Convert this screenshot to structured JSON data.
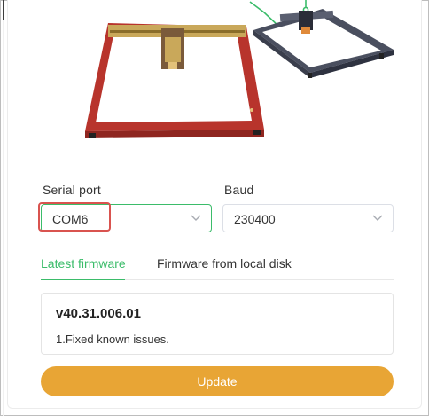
{
  "serial_port": {
    "label": "Serial port",
    "value": "COM6"
  },
  "baud": {
    "label": "Baud",
    "value": "230400"
  },
  "tabs": [
    {
      "label": "Latest firmware",
      "active": true
    },
    {
      "label": "Firmware from local disk",
      "active": false
    }
  ],
  "firmware": {
    "version": "v40.31.006.01",
    "notes": "1.Fixed known issues."
  },
  "update_button": {
    "label": "Update"
  },
  "colors": {
    "accent": "#3bbc6a",
    "button": "#e8a535",
    "highlight": "#d9534f",
    "machine_red": "#b8342c",
    "machine_gray": "#4a4f5f"
  },
  "icons": [
    "chevron-down-icon"
  ]
}
